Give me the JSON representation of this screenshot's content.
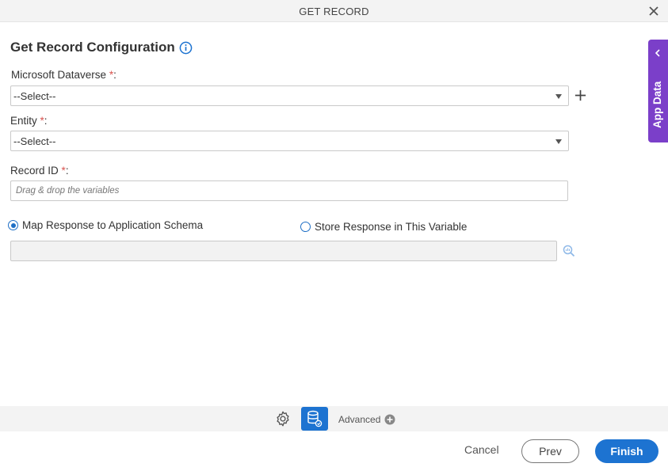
{
  "window": {
    "title": "GET RECORD"
  },
  "form": {
    "heading": "Get Record Configuration",
    "dataverse": {
      "label": "Microsoft Dataverse",
      "required_mark": "*",
      "suffix": ":",
      "value": "--Select--"
    },
    "entity": {
      "label": "Entity",
      "required_mark": "*",
      "suffix": ":",
      "value": "--Select--"
    },
    "record_id": {
      "label": "Record ID",
      "required_mark": "*",
      "suffix": ":",
      "placeholder": "Drag & drop the variables"
    },
    "response": {
      "option_map": "Map Response to Application Schema",
      "option_store": "Store Response in This Variable",
      "selected": "map"
    }
  },
  "side_panel": {
    "label": "App Data"
  },
  "toolbar": {
    "advanced_label": "Advanced"
  },
  "footer": {
    "cancel": "Cancel",
    "prev": "Prev",
    "finish": "Finish"
  },
  "colors": {
    "accent": "#1d73d1",
    "panel": "#7b3fc9",
    "required": "#d9534f"
  }
}
